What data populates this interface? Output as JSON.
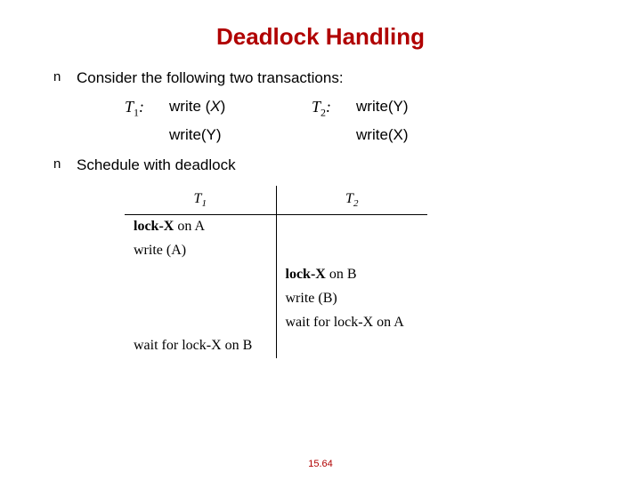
{
  "title": "Deadlock Handling",
  "bullets": {
    "marker": "n",
    "b1": "Consider the following two transactions:",
    "b2": "Schedule with deadlock"
  },
  "trans": {
    "t1label_pre": "T",
    "t1label_sub": "1",
    "t1label_post": ":",
    "t1op1_pre": "write (",
    "t1op1_var": "X",
    "t1op1_post": ")",
    "t1op2": "write(Y)",
    "t2label_pre": "T",
    "t2label_sub": "2",
    "t2label_post": ":",
    "t2op1": "write(Y)",
    "t2op2": "write(X)"
  },
  "schedule": {
    "h1_pre": "T",
    "h1_sub": "1",
    "h2_pre": "T",
    "h2_sub": "2",
    "rows": {
      "r1c1_a": "lock-X",
      "r1c1_b": " on A",
      "r2c1": "write (A)",
      "r3c2_a": "lock-X",
      "r3c2_b": " on B",
      "r4c2": "write (B)",
      "r5c2": "wait for lock-X on A",
      "r6c1": "wait for lock-X on B"
    }
  },
  "pagenum": "15.64"
}
